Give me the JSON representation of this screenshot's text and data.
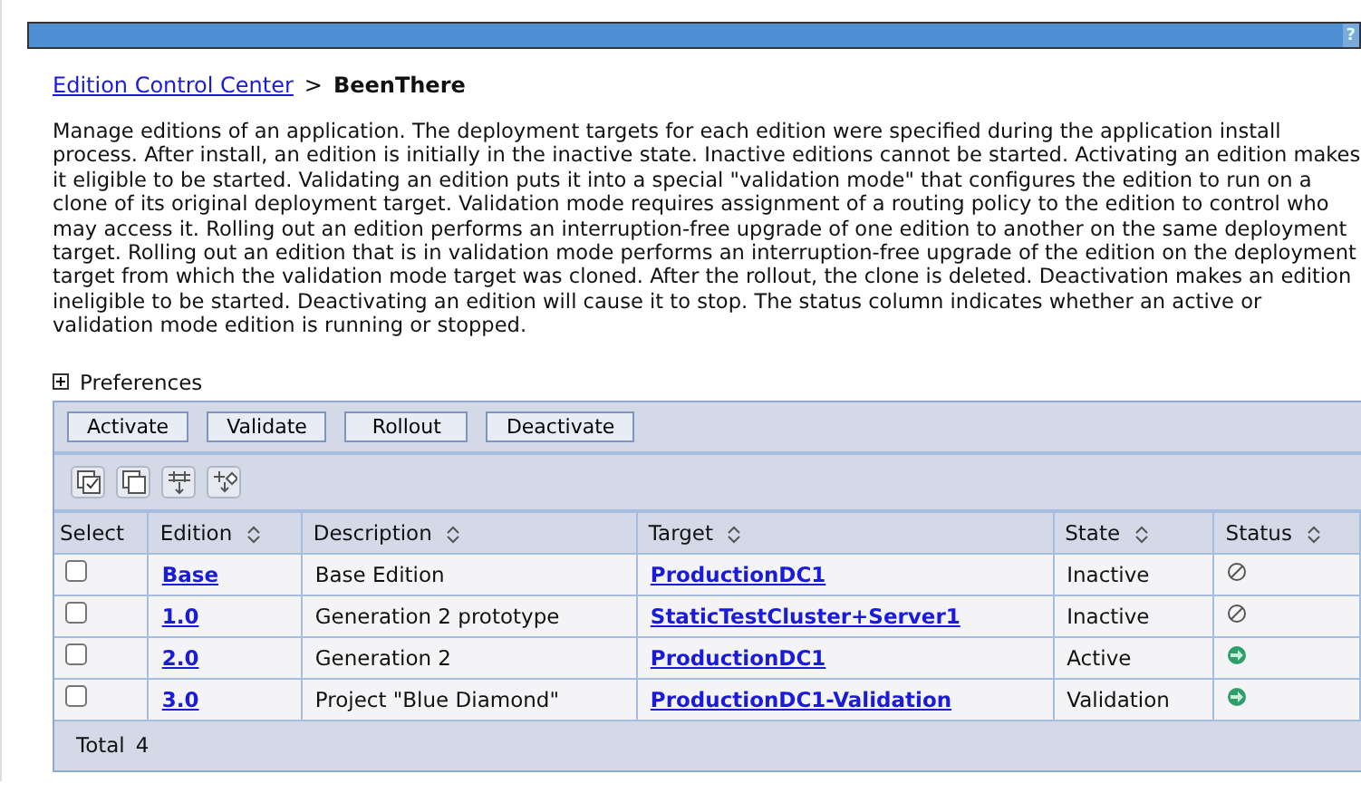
{
  "header": {
    "help": "?"
  },
  "breadcrumb": {
    "link": "Edition Control Center",
    "separator": ">",
    "current": "BeenThere"
  },
  "description": "Manage editions of an application. The deployment targets for each edition were specified during the application install process. After install, an edition is initially in the inactive state. Inactive editions cannot be started.  Activating an edition makes it eligible to be started. Validating an edition puts it into a special \"validation mode\" that configures the edition to run on a clone of its original deployment target. Validation mode requires assignment of a routing policy to the edition to control who may access it. Rolling out an edition performs an interruption-free upgrade of one edition to another on the same deployment target.  Rolling out an edition that is in validation mode performs an interruption-free upgrade of the edition on the deployment target from which the validation mode target was cloned. After the rollout, the clone is deleted. Deactivation makes an edition ineligible to be started.  Deactivating an edition will cause it to stop. The status column indicates whether an active or validation mode edition is running or stopped.",
  "preferences": {
    "label": "Preferences",
    "expanded": false
  },
  "buttons": [
    "Activate",
    "Validate",
    "Rollout",
    "Deactivate"
  ],
  "table": {
    "columns": [
      "Select",
      "Edition",
      "Description",
      "Target",
      "State",
      "Status"
    ],
    "rows": [
      {
        "checked": false,
        "edition": "Base",
        "description": "Base Edition",
        "target": "ProductionDC1",
        "state": "Inactive",
        "running": false
      },
      {
        "checked": false,
        "edition": "1.0",
        "description": "Generation 2 prototype",
        "target": "StaticTestCluster+Server1",
        "state": "Inactive",
        "running": false
      },
      {
        "checked": false,
        "edition": "2.0",
        "description": "Generation 2",
        "target": "ProductionDC1",
        "state": "Active",
        "running": true
      },
      {
        "checked": false,
        "edition": "3.0",
        "description": "Project \"Blue Diamond\"",
        "target": "ProductionDC1-Validation",
        "state": "Validation",
        "running": true
      }
    ],
    "total_label": "Total",
    "total": "4"
  }
}
